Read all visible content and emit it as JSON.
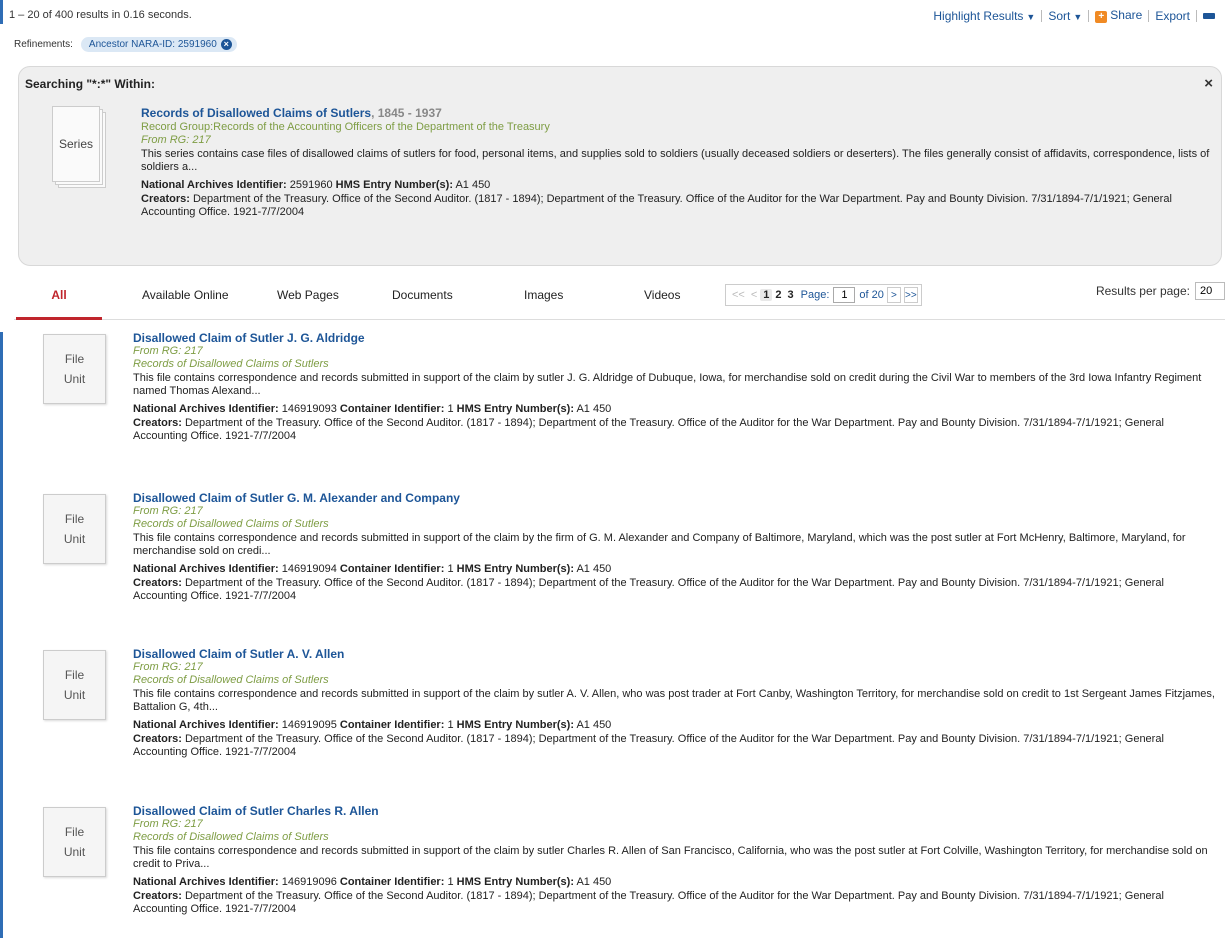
{
  "header": {
    "result_count": "1 – 20 of 400 results in 0.16 seconds.",
    "highlight_label": "Highlight Results",
    "sort_label": "Sort",
    "share_label": "Share",
    "export_label": "Export"
  },
  "refinements": {
    "label": "Refinements:",
    "chip": "Ancestor NARA-ID: 2591960"
  },
  "within": {
    "title": "Searching \"*:*\" Within:",
    "close": "×",
    "icon_label": "Series",
    "record_title": "Records of Disallowed Claims of Sutlers",
    "record_dates": ", 1845 - 1937",
    "record_group": "Record Group:Records of the Accounting Officers of the Department of the Treasury",
    "from_rg": "From RG: 217",
    "description": "This series contains case files of disallowed claims of sutlers for food, personal items, and supplies sold to soldiers (usually deceased soldiers or deserters). The files generally consist of affidavits, correspondence, lists of soldiers a...",
    "naid_label": "National Archives Identifier:",
    "naid": "2591960",
    "hms_label": "HMS Entry Number(s):",
    "hms": "A1 450",
    "creators_label": "Creators:",
    "creators": "Department of the Treasury. Office of the Second Auditor. (1817 - 1894); Department of the Treasury. Office of the Auditor for the War Department. Pay and Bounty Division. 7/31/1894-7/1/1921; General Accounting Office. 1921-7/7/2004"
  },
  "tabs": [
    "All",
    "Available Online",
    "Web Pages",
    "Documents",
    "Images",
    "Videos"
  ],
  "pager": {
    "first": "<<",
    "prev": "<",
    "pages": [
      "1",
      "2",
      "3"
    ],
    "page_label": "Page:",
    "page_value": "1",
    "of_label": "of 20",
    "next": ">",
    "last": ">>",
    "rpp_label": "Results per page:",
    "rpp_value": "20"
  },
  "results": [
    {
      "icon_line1": "File",
      "icon_line2": "Unit",
      "title": "Disallowed Claim of Sutler J. G. Aldridge",
      "from_rg": "From RG: 217",
      "parent": "Records of Disallowed Claims of Sutlers",
      "description": "This file contains correspondence and records submitted in support of the claim by sutler J. G. Aldridge of Dubuque, Iowa, for merchandise sold on credit during the Civil War to members of the 3rd Iowa Infantry Regiment named Thomas Alexand...",
      "naid_label": "National Archives Identifier:",
      "naid": "146919093",
      "container_label": "Container Identifier:",
      "container": "1",
      "hms_label": "HMS Entry Number(s):",
      "hms": "A1 450",
      "creators_label": "Creators:",
      "creators": "Department of the Treasury. Office of the Second Auditor. (1817 - 1894); Department of the Treasury. Office of the Auditor for the War Department. Pay and Bounty Division. 7/31/1894-7/1/1921; General Accounting Office. 1921-7/7/2004"
    },
    {
      "icon_line1": "File",
      "icon_line2": "Unit",
      "title": "Disallowed Claim of Sutler G. M. Alexander and Company",
      "from_rg": "From RG: 217",
      "parent": "Records of Disallowed Claims of Sutlers",
      "description": "This file contains correspondence and records submitted in support of the claim by the firm of G. M. Alexander and Company of Baltimore, Maryland, which was the post sutler at Fort McHenry, Baltimore, Maryland, for merchandise sold on credi...",
      "naid_label": "National Archives Identifier:",
      "naid": "146919094",
      "container_label": "Container Identifier:",
      "container": "1",
      "hms_label": "HMS Entry Number(s):",
      "hms": "A1 450",
      "creators_label": "Creators:",
      "creators": "Department of the Treasury. Office of the Second Auditor. (1817 - 1894); Department of the Treasury. Office of the Auditor for the War Department. Pay and Bounty Division. 7/31/1894-7/1/1921; General Accounting Office. 1921-7/7/2004"
    },
    {
      "icon_line1": "File",
      "icon_line2": "Unit",
      "title": "Disallowed Claim of Sutler A. V. Allen",
      "from_rg": "From RG: 217",
      "parent": "Records of Disallowed Claims of Sutlers",
      "description": "This file contains correspondence and records submitted in support of the claim by sutler A. V. Allen, who was post trader at Fort Canby, Washington Territory, for merchandise sold on credit to 1st Sergeant James Fitzjames, Battalion G, 4th...",
      "naid_label": "National Archives Identifier:",
      "naid": "146919095",
      "container_label": "Container Identifier:",
      "container": "1",
      "hms_label": "HMS Entry Number(s):",
      "hms": "A1 450",
      "creators_label": "Creators:",
      "creators": "Department of the Treasury. Office of the Second Auditor. (1817 - 1894); Department of the Treasury. Office of the Auditor for the War Department. Pay and Bounty Division. 7/31/1894-7/1/1921; General Accounting Office. 1921-7/7/2004"
    },
    {
      "icon_line1": "File",
      "icon_line2": "Unit",
      "title": "Disallowed Claim of Sutler Charles R. Allen",
      "from_rg": "From RG: 217",
      "parent": "Records of Disallowed Claims of Sutlers",
      "description": "This file contains correspondence and records submitted in support of the claim by sutler Charles R. Allen of San Francisco, California, who was the post sutler at Fort Colville, Washington Territory, for merchandise sold on credit to Priva...",
      "naid_label": "National Archives Identifier:",
      "naid": "146919096",
      "container_label": "Container Identifier:",
      "container": "1",
      "hms_label": "HMS Entry Number(s):",
      "hms": "A1 450",
      "creators_label": "Creators:",
      "creators": "Department of the Treasury. Office of the Second Auditor. (1817 - 1894); Department of the Treasury. Office of the Auditor for the War Department. Pay and Bounty Division. 7/31/1894-7/1/1921; General Accounting Office. 1921-7/7/2004"
    }
  ]
}
